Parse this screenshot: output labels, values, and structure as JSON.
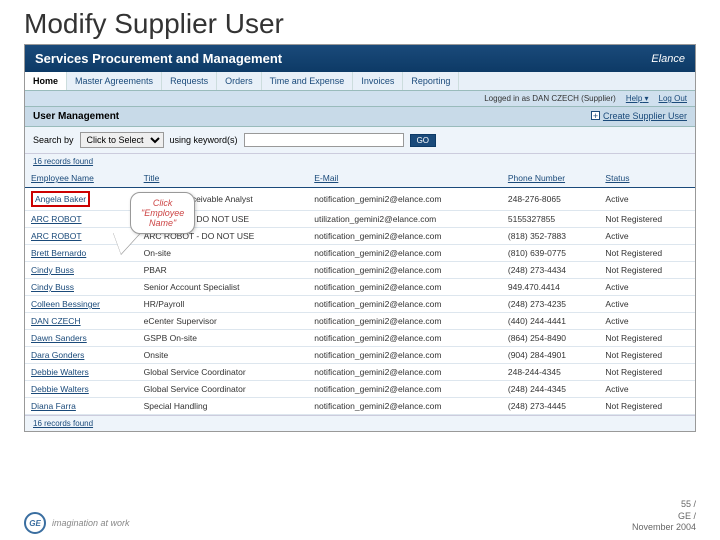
{
  "slide": {
    "title": "Modify Supplier User"
  },
  "app": {
    "title": "Services Procurement and Management",
    "vendor": "Elance"
  },
  "tabs": [
    "Home",
    "Master Agreements",
    "Requests",
    "Orders",
    "Time and Expense",
    "Invoices",
    "Reporting"
  ],
  "active_tab": 0,
  "subbar": {
    "logged_in": "Logged in as DAN CZECH (Supplier)",
    "help": "Help",
    "logout": "Log Out"
  },
  "section": {
    "title": "User Management",
    "action": "Create Supplier User"
  },
  "search": {
    "label": "Search by",
    "select_placeholder": "Click to Select",
    "keywords_label": "using keyword(s)",
    "go": "GO"
  },
  "records": {
    "top": "16 records found",
    "bottom": "16 records found"
  },
  "columns": [
    "Employee Name",
    "Title",
    "E-Mail",
    "Phone Number",
    "Status"
  ],
  "rows": [
    {
      "name": "Angela Baker",
      "title": "Accounts Receivable Analyst",
      "email": "notification_gemini2@elance.com",
      "phone": "248-276-8065",
      "status": "Active"
    },
    {
      "name": "ARC ROBOT",
      "title": "ARC ROBOT DO NOT USE",
      "email": "utilization_gemini2@elance.com",
      "phone": "5155327855",
      "status": "Not Registered"
    },
    {
      "name": "ARC ROBOT",
      "title": "ARC ROBOT - DO NOT USE",
      "email": "notification_gemini2@elance.com",
      "phone": "(818) 352-7883",
      "status": "Active"
    },
    {
      "name": "Brett Bernardo",
      "title": "On-site",
      "email": "notification_gemini2@elance.com",
      "phone": "(810) 639-0775",
      "status": "Not Registered"
    },
    {
      "name": "Cindy Buss",
      "title": "PBAR",
      "email": "notification_gemini2@elance.com",
      "phone": "(248) 273-4434",
      "status": "Not Registered"
    },
    {
      "name": "Cindy Buss",
      "title": "Senior Account Specialist",
      "email": "notification_gemini2@elance.com",
      "phone": "949.470.4414",
      "status": "Active"
    },
    {
      "name": "Colleen Bessinger",
      "title": "HR/Payroll",
      "email": "notification_gemini2@elance.com",
      "phone": "(248) 273-4235",
      "status": "Active"
    },
    {
      "name": "DAN CZECH",
      "title": "eCenter Supervisor",
      "email": "notification_gemini2@elance.com",
      "phone": "(440) 244-4441",
      "status": "Active"
    },
    {
      "name": "Dawn Sanders",
      "title": "GSPB On-site",
      "email": "notification_gemini2@elance.com",
      "phone": "(864) 254-8490",
      "status": "Not Registered"
    },
    {
      "name": "Dara Gonders",
      "title": "Onsite",
      "email": "notification_gemini2@elance.com",
      "phone": "(904) 284-4901",
      "status": "Not Registered"
    },
    {
      "name": "Debbie Walters",
      "title": "Global Service Coordinator",
      "email": "notification_gemini2@elance.com",
      "phone": "248-244-4345",
      "status": "Not Registered"
    },
    {
      "name": "Debbie Walters",
      "title": "Global Service Coordinator",
      "email": "notification_gemini2@elance.com",
      "phone": "(248) 244-4345",
      "status": "Active"
    },
    {
      "name": "Diana Farra",
      "title": "Special Handling",
      "email": "notification_gemini2@elance.com",
      "phone": "(248) 273-4445",
      "status": "Not Registered"
    }
  ],
  "callout": {
    "line1": "Click",
    "line2": "\"Employee",
    "line3": "Name\""
  },
  "footer": {
    "tagline": "imagination at work",
    "page": "55 /",
    "org": "GE /",
    "date": "November 2004"
  }
}
